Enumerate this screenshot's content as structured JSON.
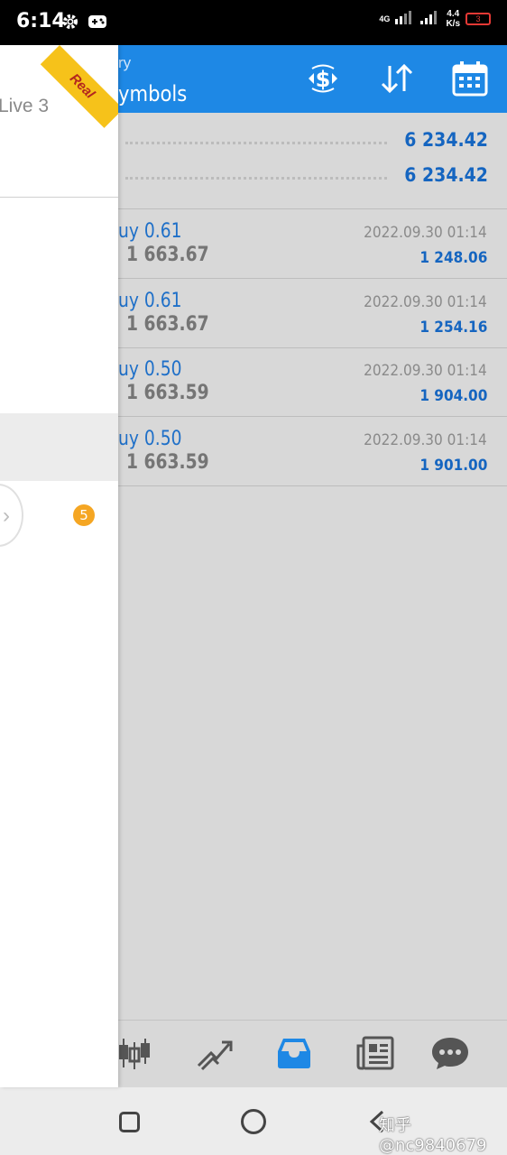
{
  "status_bar": {
    "time": "6:14",
    "network": "4G",
    "speed_value": "4.4",
    "speed_unit": "K/s",
    "battery": "3"
  },
  "header": {
    "subtitle": "ry",
    "title": "ymbols",
    "icons": [
      "deposit-currency-icon",
      "sort-icon",
      "calendar-icon"
    ]
  },
  "drawer": {
    "badge": "Real",
    "account": "Live 3",
    "notification_count": "5"
  },
  "summary": [
    {
      "value": "6 234.42"
    },
    {
      "value": "6 234.42"
    }
  ],
  "trades": [
    {
      "type": "uy 0.61",
      "price": "1 663.67",
      "time": "2022.09.30 01:14",
      "profit": "1 248.06"
    },
    {
      "type": "uy 0.61",
      "price": "1 663.67",
      "time": "2022.09.30 01:14",
      "profit": "1 254.16"
    },
    {
      "type": "uy 0.50",
      "price": "1 663.59",
      "time": "2022.09.30 01:14",
      "profit": "1 904.00"
    },
    {
      "type": "uy 0.50",
      "price": "1 663.59",
      "time": "2022.09.30 01:14",
      "profit": "1 901.00"
    }
  ],
  "tabbar": {
    "tabs": [
      "quotes-candles-icon",
      "trade-chart-icon",
      "history-inbox-icon",
      "news-icon",
      "messages-icon"
    ],
    "active": "history-inbox-icon",
    "active_color": "#1e88e5"
  },
  "watermark": "知乎 @nc9840679",
  "colors": {
    "primary": "#1e88e5",
    "value_blue": "#1565c0",
    "ribbon": "#f6c21a",
    "badge": "#f5a623"
  }
}
